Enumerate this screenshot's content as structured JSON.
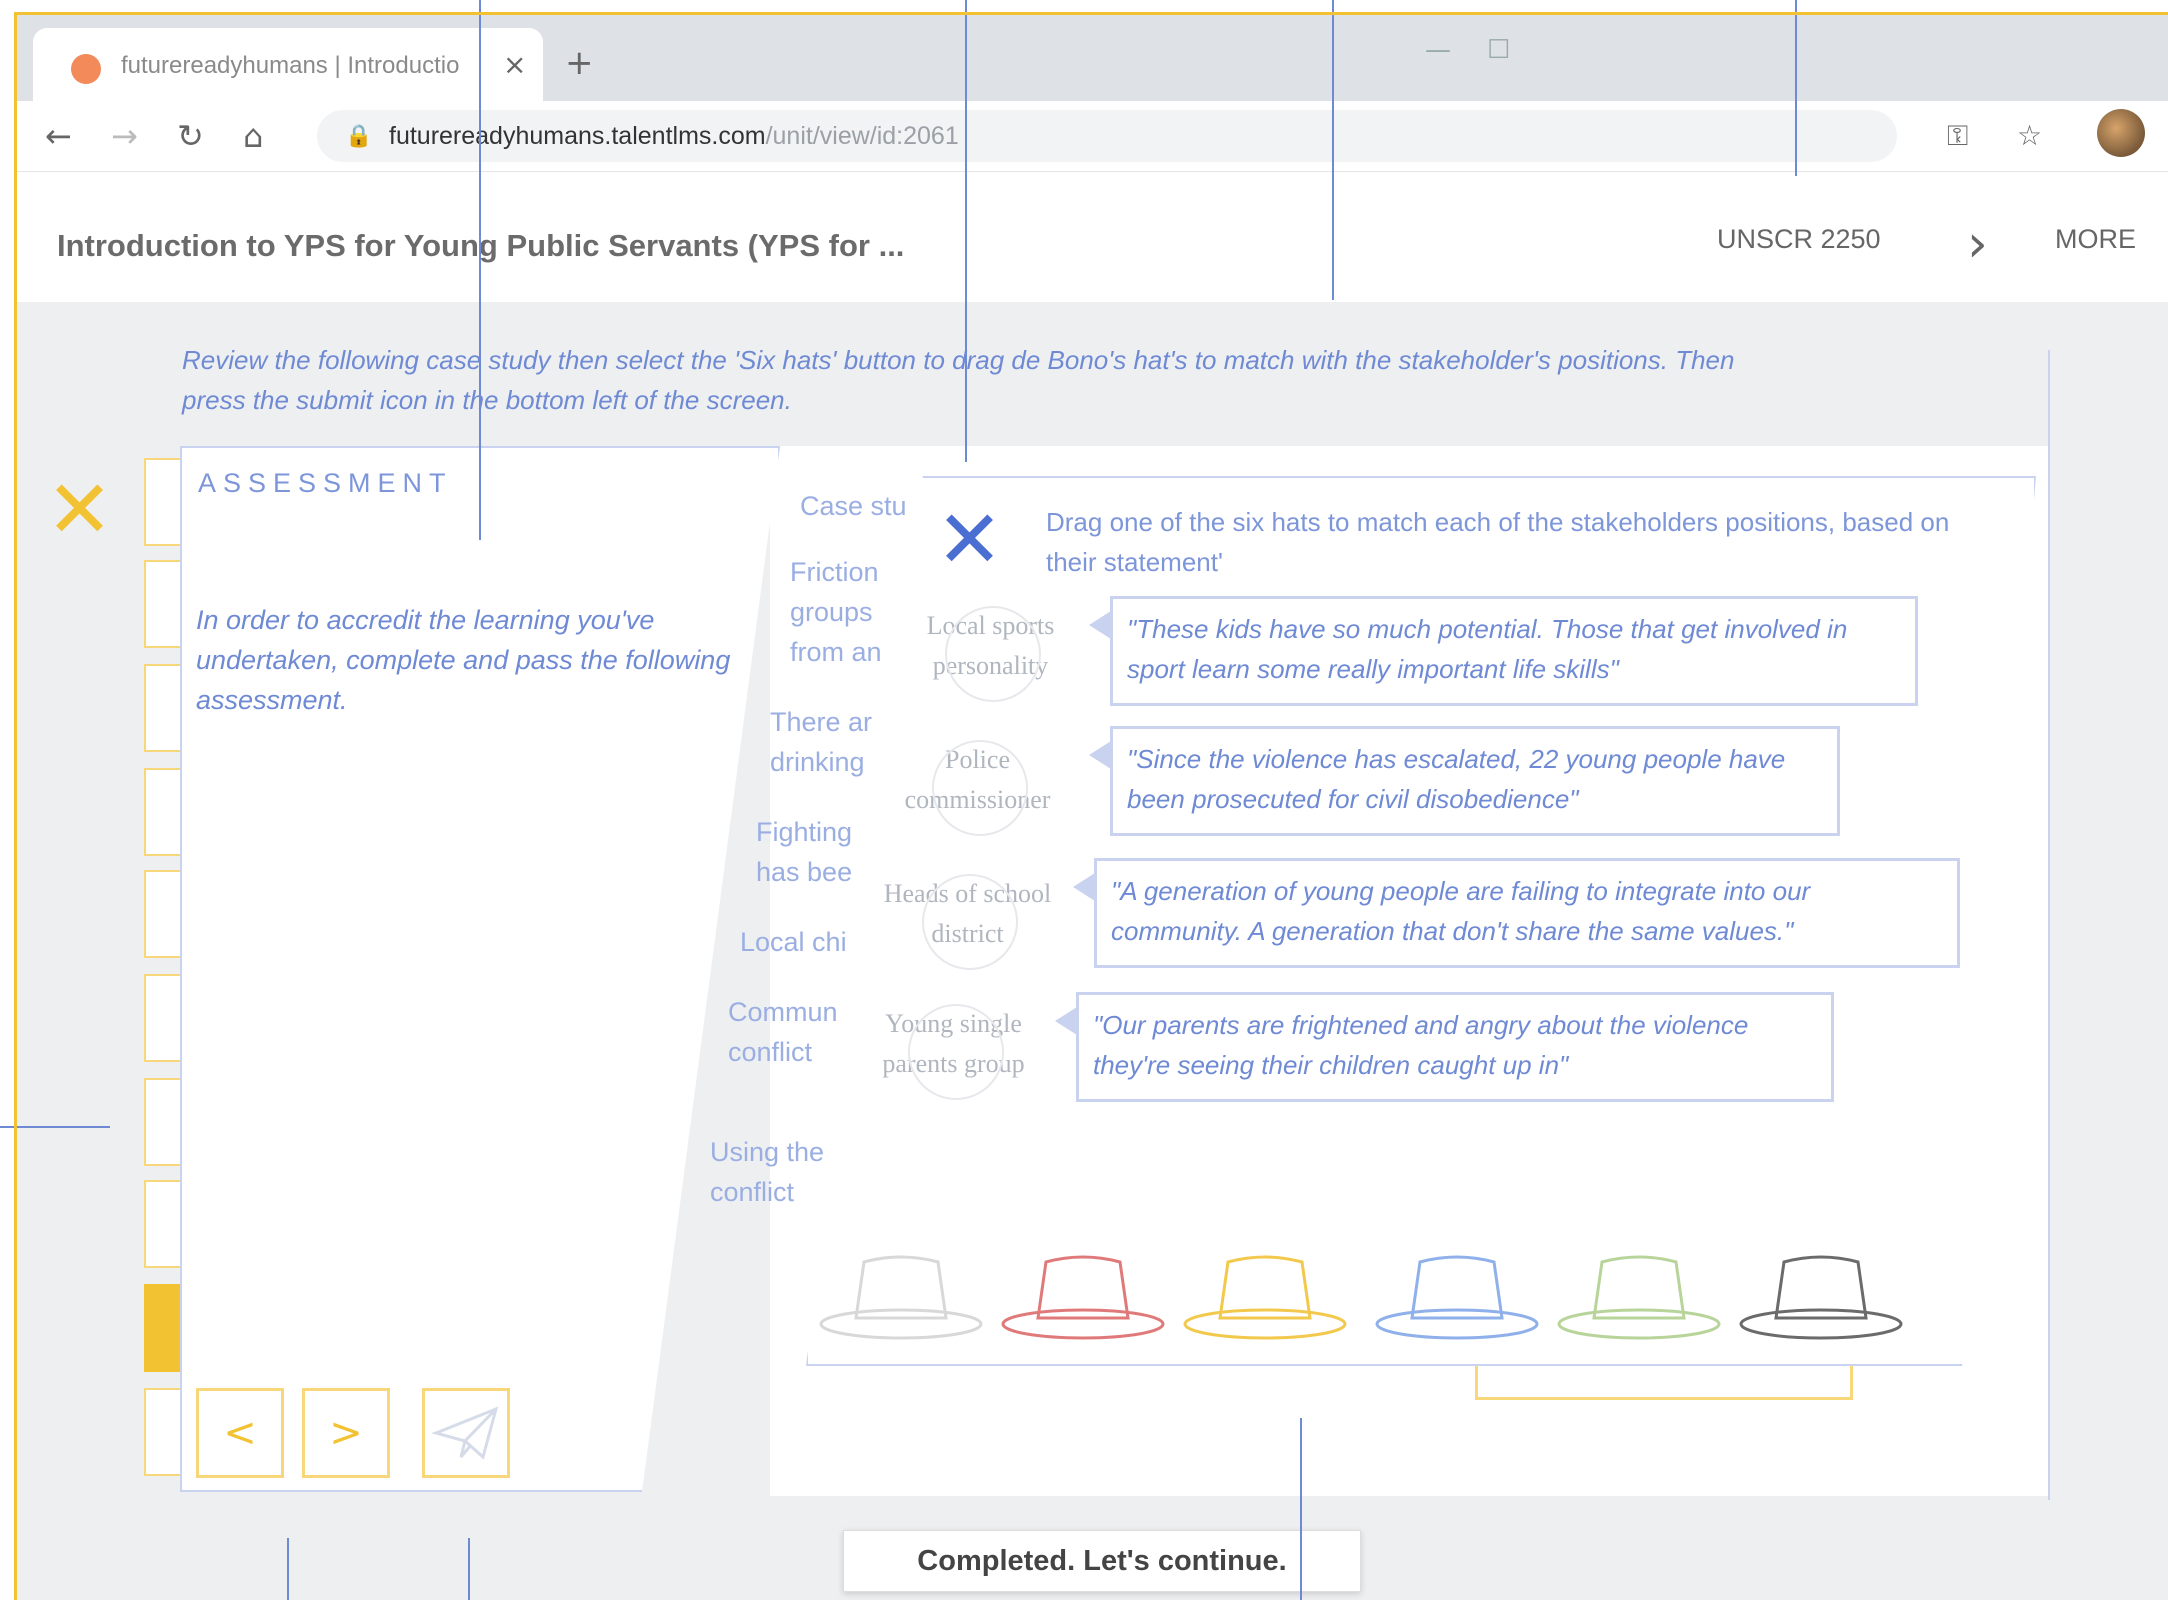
{
  "browser": {
    "tab_title": "futurereadyhumans | Introductio",
    "close_glyph": "×",
    "new_tab_glyph": "+",
    "url_host": "futurereadyhumans.talentlms.com",
    "url_path": "/unit/view/id:2061"
  },
  "header": {
    "page_title": "Introduction to YPS for Young Public Servants (YPS for ...",
    "unit_dropdown": "UNSCR 2250",
    "more_menu": "MORE",
    "next_glyph": "›"
  },
  "content": {
    "instructions": "Review the following case study then select the 'Six hats' button to drag de Bono's hat's to match with the stakeholder's positions. Then press the submit icon in the bottom left of the screen.",
    "assessment": {
      "heading": "ASSESSMENT",
      "text": "In order to accredit the learning you've undertaken, complete and pass the following assessment.",
      "prev_label": "<",
      "next_label": ">"
    },
    "case_fragments": [
      "Case stu",
      "Friction",
      "groups",
      "from an",
      "There ar",
      "drinking",
      "Fighting",
      "has bee",
      "Local chi",
      "Commun",
      "conflict",
      "Using the",
      "conflict"
    ],
    "dialog": {
      "instruction": "Drag one of the six hats to match each of the stakeholders positions, based on their statement'",
      "stakeholders": [
        {
          "name": "Local sports personality",
          "quote": "\"These kids have so much potential. Those that get involved in sport learn some really important life skills\""
        },
        {
          "name": "Police commissioner",
          "quote": "\"Since the violence has escalated, 22 young people have been prosecuted for civil disobedience\""
        },
        {
          "name": "Heads of school district",
          "quote": "\"A generation of young people are failing to integrate into our community. A generation that don't share the same values.\""
        },
        {
          "name": "Young single parents group",
          "quote": "\"Our parents are frightened and angry about the violence they're seeing their children caught up in\""
        }
      ],
      "hats": [
        {
          "name": "white-hat",
          "color": "#d8d8d8"
        },
        {
          "name": "red-hat",
          "color": "#e07a7a"
        },
        {
          "name": "yellow-hat",
          "color": "#f2c94c"
        },
        {
          "name": "blue-hat",
          "color": "#8fb0ea"
        },
        {
          "name": "green-hat",
          "color": "#b8d49a"
        },
        {
          "name": "black-hat",
          "color": "#6b6b6b"
        }
      ]
    },
    "toast": "Completed. Let's continue."
  }
}
